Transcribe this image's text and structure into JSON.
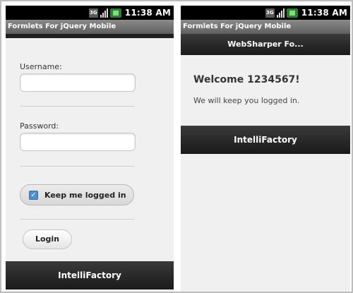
{
  "status_bar": {
    "time": "11:38 AM",
    "network_label": "3G",
    "icons": [
      "3g-icon",
      "signal-icon",
      "battery-icon"
    ]
  },
  "left_screen": {
    "app_title": "Formlets For jQuery Mobile",
    "form": {
      "username_label": "Username:",
      "username_value": "",
      "password_label": "Password:",
      "password_value": "",
      "keep_logged_in_label": "Keep me logged in",
      "keep_logged_in_checked": true,
      "login_button": "Login"
    },
    "footer": "IntelliFactory"
  },
  "right_screen": {
    "app_title": "Formlets For jQuery Mobile",
    "header": "WebSharper Fo...",
    "welcome_title": "Welcome 1234567!",
    "welcome_text": "We will keep you logged in.",
    "footer": "IntelliFactory"
  },
  "colors": {
    "checkbox": "#4d8fd1",
    "bar_dark": "#1a1a1a",
    "title_bar": "#6f6f6f",
    "background": "#f0f0f0"
  }
}
